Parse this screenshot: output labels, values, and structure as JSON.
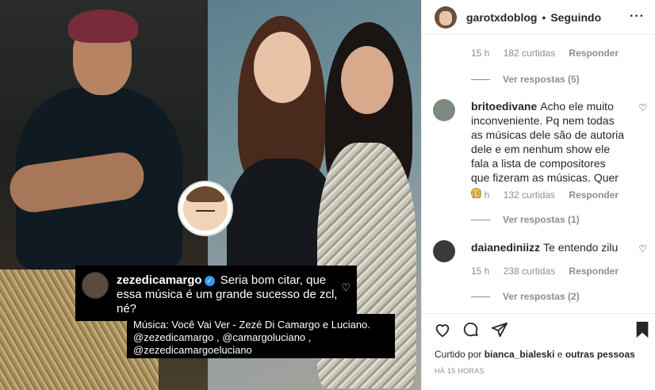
{
  "image": {
    "overlay": {
      "username": "zezedicamargo",
      "text": "Seria bom citar, que essa música é um grande sucesso de zcl, né?"
    },
    "music": {
      "line1": "Música: Você Vai Ver - Zezé Di Camargo e Luciano.",
      "line2": "@zezedicamargo , @camargoluciano ,",
      "line3": "@zezedicamargoeluciano"
    }
  },
  "header": {
    "username": "garotxdoblog",
    "dot": "•",
    "following": "Seguindo",
    "more": "···"
  },
  "comments": {
    "top_meta": {
      "time": "15 h",
      "likes": "182 curtidas",
      "reply": "Responder"
    },
    "top_replies": "Ver respostas (5)",
    "c1": {
      "user": "britoedivane",
      "text": "Acho ele muito inconveniente. Pq nem todas as músicas dele são de autoria dele e em nenhum show ele fala a lista de compositores que fizeram as músicas. Quer",
      "time": "15 h",
      "likes": "132 curtidas",
      "reply": "Responder",
      "replies": "Ver respostas (1)"
    },
    "c2": {
      "user": "daianediniizz",
      "text": "Te entendo zilu",
      "time": "15 h",
      "likes": "238 curtidas",
      "reply": "Responder",
      "replies": "Ver respostas (2)"
    }
  },
  "footer": {
    "liked_prefix": "Curtido por",
    "liked_user": "bianca_bialeski",
    "liked_conj": "e",
    "liked_others": "outras pessoas",
    "time": "HÁ 15 HORAS"
  },
  "colors": {
    "accent": "#3897f0",
    "muted": "#8e8e8e",
    "text": "#262626"
  },
  "icons": [
    "heart-icon",
    "comment-icon",
    "share-icon",
    "bookmark-icon",
    "more-icon",
    "verified-icon"
  ]
}
